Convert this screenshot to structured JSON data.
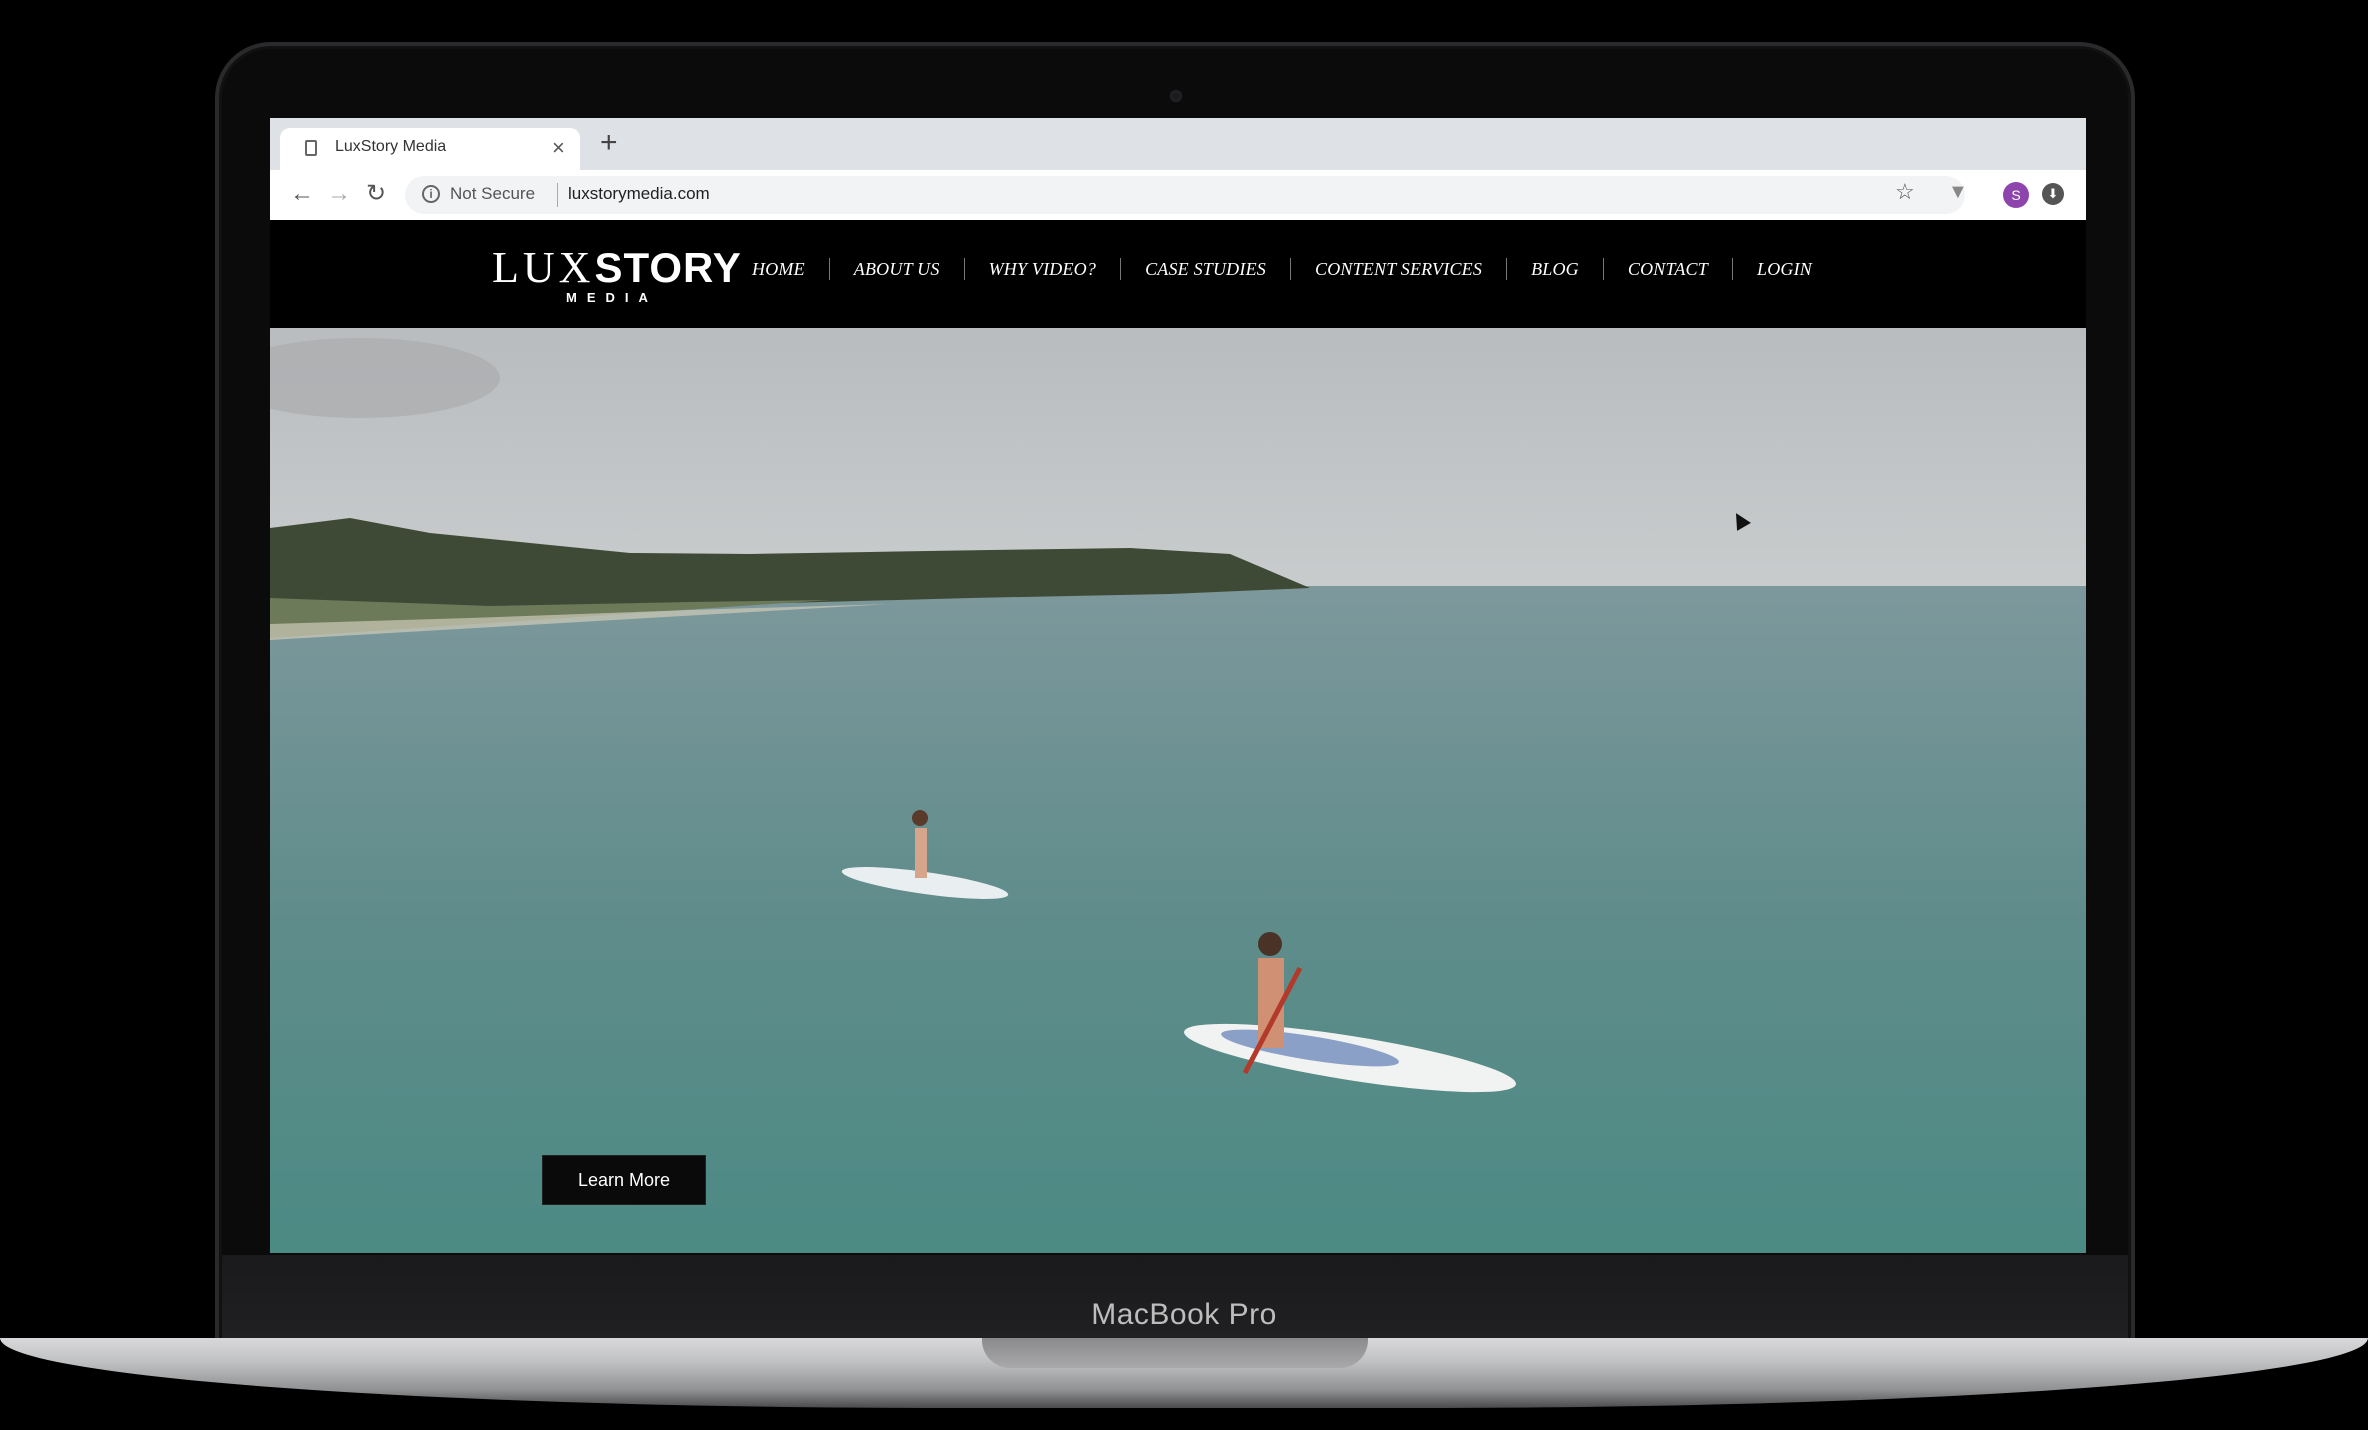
{
  "device": {
    "model_label": "MacBook Pro"
  },
  "browser": {
    "tab_title": "LuxStory Media",
    "new_tab_icon": "plus-icon",
    "security_text": "Not Secure",
    "url": "luxstorymedia.com",
    "avatar_letter": "S"
  },
  "site": {
    "logo": {
      "lux": "LUX",
      "story": "STORY",
      "media": "MEDIA"
    },
    "nav": [
      "HOME",
      "ABOUT US",
      "WHY VIDEO?",
      "CASE STUDIES",
      "CONTENT SERVICES",
      "BLOG",
      "CONTACT",
      "LOGIN"
    ],
    "hero": {
      "cta_label": "Learn More"
    }
  }
}
